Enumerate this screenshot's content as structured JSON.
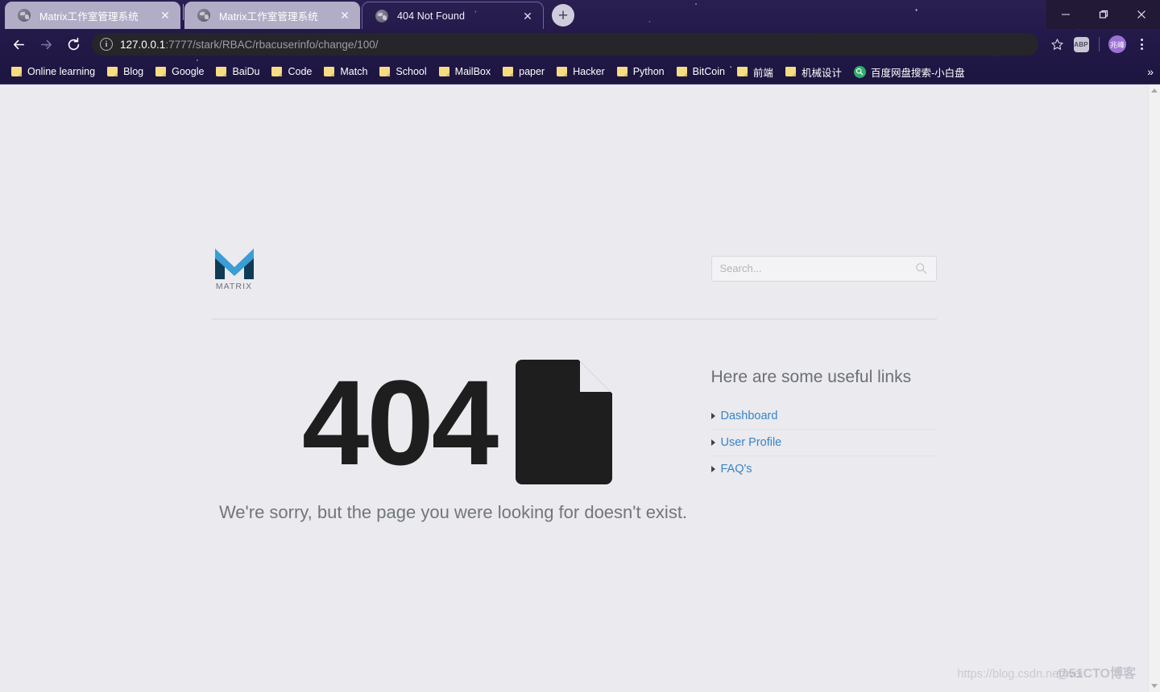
{
  "browser": {
    "tabs": [
      {
        "title": "Matrix工作室管理系统",
        "active": false,
        "close_label": "✕"
      },
      {
        "title": "Matrix工作室管理系统",
        "active": false,
        "close_label": "✕"
      },
      {
        "title": "404 Not Found",
        "active": true,
        "close_label": "✕"
      }
    ],
    "new_tab_label": "+",
    "window_controls": {
      "minimize": "minimize-icon",
      "maximize": "maximize-icon",
      "close": "close-icon"
    },
    "nav": {
      "back": "back-arrow-icon",
      "forward": "forward-arrow-icon",
      "reload": "reload-icon"
    },
    "omnibox": {
      "security_icon": "info-circle-icon",
      "security_glyph": "i",
      "url_host": "127.0.0.1",
      "url_path": ":7777/stark/RBAC/rbacuserinfo/change/100/"
    },
    "toolbar_right": {
      "bookmark_star": "star-icon",
      "extension_label": "ABP",
      "profile_label": "兆峰",
      "menu": "kebab-menu-icon"
    },
    "bookmarks": [
      {
        "label": "Online learning",
        "icon": "folder-icon"
      },
      {
        "label": "Blog",
        "icon": "folder-icon"
      },
      {
        "label": "Google",
        "icon": "folder-icon"
      },
      {
        "label": "BaiDu",
        "icon": "folder-icon"
      },
      {
        "label": "Code",
        "icon": "folder-icon"
      },
      {
        "label": "Match",
        "icon": "folder-icon"
      },
      {
        "label": "School",
        "icon": "folder-icon"
      },
      {
        "label": "MailBox",
        "icon": "folder-icon"
      },
      {
        "label": "paper",
        "icon": "folder-icon"
      },
      {
        "label": "Hacker",
        "icon": "folder-icon"
      },
      {
        "label": "Python",
        "icon": "folder-icon"
      },
      {
        "label": "BitCoin",
        "icon": "folder-icon"
      },
      {
        "label": "前端",
        "icon": "folder-icon"
      },
      {
        "label": "机械设计",
        "icon": "folder-icon"
      },
      {
        "label": "百度网盘搜索-小白盘",
        "icon": "baidu-search-icon"
      }
    ],
    "bookmarks_overflow_label": "»"
  },
  "page": {
    "logo": {
      "icon": "matrix-m-logo",
      "wordmark": "MATRIX"
    },
    "search": {
      "placeholder": "Search...",
      "value": "",
      "icon": "search-icon"
    },
    "error": {
      "code": "404",
      "doc_icon": "document-page-icon",
      "message": "We're sorry, but the page you were looking for doesn't exist."
    },
    "links_panel": {
      "title": "Here are some useful links",
      "items": [
        {
          "label": "Dashboard"
        },
        {
          "label": "User Profile"
        },
        {
          "label": "FAQ's"
        }
      ]
    },
    "scrollbar": {
      "up": "scroll-up-arrow-icon",
      "down": "scroll-down-arrow-icon"
    }
  },
  "watermarks": {
    "primary": "https://blog.csdn.net/wei",
    "secondary": "@51CTO博客"
  },
  "colors": {
    "chrome_bg": "#241a4a",
    "page_bg": "#eaeaef",
    "link": "#3a84c3",
    "logo_light": "#3c9cd4",
    "logo_dark": "#0f3b57",
    "error_text": "#1e1e1e"
  }
}
